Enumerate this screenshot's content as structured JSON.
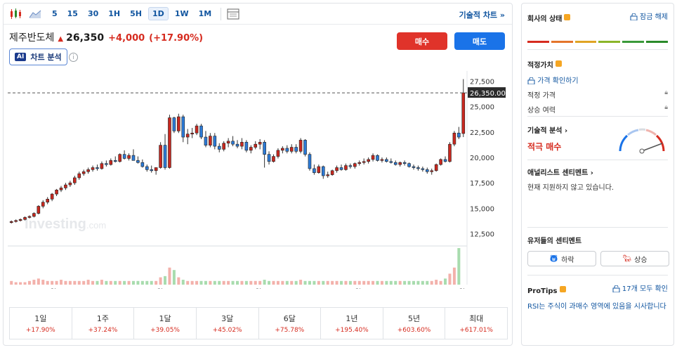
{
  "toolbar": {
    "intervals": [
      "5",
      "15",
      "30",
      "1H",
      "5H",
      "1D",
      "1W",
      "1M"
    ],
    "active_interval": "1D",
    "tech_chart_link": "기술적 차트 »"
  },
  "quote": {
    "name": "제주반도체",
    "price": "26,350",
    "change": "+4,000",
    "change_pct": "(+17.90%)",
    "buy_label": "매수",
    "sell_label": "매도",
    "ai_badge": "AI",
    "ai_label": "차트 분석",
    "info_glyph": "i"
  },
  "chart_data": {
    "type": "candlestick",
    "y_ticks": [
      "27,500",
      "25,000",
      "22,500",
      "20,000",
      "17,500",
      "15,000",
      "12,500"
    ],
    "last_price_label": "26,350.00",
    "x_ticks": [
      "20",
      "월 '25",
      "15",
      "월 '25",
      "20",
      "월 '25",
      "17",
      "월 '25",
      "15",
      "월 '"
    ],
    "watermark": "Investing",
    "watermark_suffix": ".com",
    "ohlc": [
      [
        13600,
        13800,
        13500,
        13700
      ],
      [
        13700,
        13900,
        13600,
        13800
      ],
      [
        13800,
        14000,
        13700,
        13900
      ],
      [
        13900,
        14200,
        13800,
        14100
      ],
      [
        14100,
        14300,
        14000,
        14200
      ],
      [
        14200,
        14600,
        14100,
        14500
      ],
      [
        14500,
        15300,
        14400,
        15200
      ],
      [
        15200,
        15800,
        15000,
        15600
      ],
      [
        15600,
        16100,
        15400,
        15900
      ],
      [
        15900,
        16500,
        15700,
        16400
      ],
      [
        16400,
        16900,
        16200,
        16800
      ],
      [
        16800,
        17200,
        16600,
        17000
      ],
      [
        17000,
        17500,
        16800,
        17300
      ],
      [
        17300,
        17700,
        17100,
        17500
      ],
      [
        17500,
        18200,
        17300,
        18000
      ],
      [
        18000,
        18600,
        17800,
        18400
      ],
      [
        18400,
        18800,
        18200,
        18600
      ],
      [
        18600,
        19000,
        18400,
        18800
      ],
      [
        18800,
        19200,
        18600,
        19000
      ],
      [
        19000,
        19300,
        18700,
        18900
      ],
      [
        18900,
        19600,
        18800,
        19400
      ],
      [
        19400,
        19700,
        19100,
        19300
      ],
      [
        19300,
        19900,
        19200,
        19700
      ],
      [
        19700,
        20100,
        19500,
        19600
      ],
      [
        19600,
        20400,
        19500,
        20300
      ],
      [
        20300,
        20700,
        19800,
        19900
      ],
      [
        19900,
        20400,
        19700,
        20200
      ],
      [
        20200,
        20800,
        19800,
        19700
      ],
      [
        19700,
        20100,
        19400,
        19500
      ],
      [
        19500,
        19800,
        19000,
        19100
      ],
      [
        19100,
        19300,
        18600,
        18800
      ],
      [
        18800,
        19200,
        18500,
        18700
      ],
      [
        18700,
        19000,
        18300,
        19000
      ],
      [
        19000,
        21500,
        18900,
        21200
      ],
      [
        21200,
        22300,
        18800,
        19000
      ],
      [
        19000,
        24200,
        18900,
        23900
      ],
      [
        23900,
        24000,
        22400,
        22600
      ],
      [
        22600,
        24300,
        22400,
        24000
      ],
      [
        24000,
        24200,
        21500,
        22000
      ],
      [
        22000,
        22800,
        21300,
        22300
      ],
      [
        22300,
        22900,
        21900,
        22400
      ],
      [
        22400,
        23300,
        22200,
        23100
      ],
      [
        23100,
        23300,
        21800,
        22000
      ],
      [
        22000,
        22600,
        21000,
        21200
      ],
      [
        21200,
        22400,
        21000,
        22100
      ],
      [
        22100,
        22400,
        20800,
        21100
      ],
      [
        21100,
        21400,
        20500,
        20800
      ],
      [
        20800,
        21600,
        20600,
        21400
      ],
      [
        21400,
        21900,
        21000,
        21600
      ],
      [
        21600,
        22100,
        21100,
        21300
      ],
      [
        21300,
        21700,
        20900,
        21100
      ],
      [
        21100,
        21900,
        20800,
        21500
      ],
      [
        21500,
        21700,
        20500,
        20700
      ],
      [
        20700,
        21200,
        20400,
        21000
      ],
      [
        21000,
        21600,
        20800,
        21300
      ],
      [
        21300,
        21800,
        20800,
        21500
      ],
      [
        21500,
        21700,
        19000,
        20300
      ],
      [
        20300,
        20600,
        19300,
        19600
      ],
      [
        19600,
        20300,
        19500,
        20100
      ],
      [
        20100,
        20900,
        19900,
        20700
      ],
      [
        20700,
        21100,
        20400,
        20900
      ],
      [
        20900,
        21200,
        20400,
        20600
      ],
      [
        20600,
        21300,
        20400,
        21000
      ],
      [
        21000,
        21300,
        20400,
        20600
      ],
      [
        20600,
        21900,
        20400,
        21700
      ],
      [
        21700,
        21800,
        20100,
        20300
      ],
      [
        20300,
        20500,
        18700,
        18900
      ],
      [
        18900,
        19300,
        18300,
        18500
      ],
      [
        18500,
        19300,
        18400,
        19100
      ],
      [
        19100,
        19200,
        17900,
        18200
      ],
      [
        18200,
        18600,
        18000,
        18300
      ],
      [
        18300,
        18800,
        18200,
        18700
      ],
      [
        18700,
        19200,
        18500,
        19000
      ],
      [
        19000,
        19300,
        18700,
        18800
      ],
      [
        18800,
        19400,
        18700,
        19200
      ],
      [
        19200,
        19400,
        18900,
        19100
      ],
      [
        19100,
        19500,
        18900,
        19400
      ],
      [
        19400,
        19700,
        19200,
        19500
      ],
      [
        19500,
        19900,
        19300,
        19600
      ],
      [
        19600,
        20000,
        19400,
        19800
      ],
      [
        19800,
        20400,
        19600,
        20200
      ],
      [
        20200,
        20300,
        19600,
        19700
      ],
      [
        19700,
        20000,
        19500,
        19800
      ],
      [
        19800,
        20000,
        19500,
        19600
      ],
      [
        19600,
        19900,
        19400,
        19500
      ],
      [
        19500,
        19700,
        19200,
        19300
      ],
      [
        19300,
        19600,
        19100,
        19500
      ],
      [
        19500,
        19700,
        19200,
        19400
      ],
      [
        19400,
        19500,
        19000,
        19100
      ],
      [
        19100,
        19300,
        18800,
        19000
      ],
      [
        19000,
        19200,
        18700,
        18900
      ],
      [
        18900,
        19100,
        18600,
        18800
      ],
      [
        18800,
        19000,
        18400,
        18600
      ],
      [
        18600,
        18900,
        18300,
        18700
      ],
      [
        18700,
        19400,
        18600,
        19300
      ],
      [
        19300,
        19900,
        19200,
        19800
      ],
      [
        19800,
        20100,
        19500,
        19600
      ],
      [
        19600,
        21500,
        19500,
        21300
      ],
      [
        21300,
        22600,
        21100,
        22400
      ],
      [
        22400,
        23000,
        21800,
        22000
      ],
      [
        22350,
        27700,
        22000,
        26350
      ]
    ],
    "volume": [
      3,
      2,
      2,
      2,
      3,
      4,
      5,
      4,
      3,
      3,
      3,
      4,
      3,
      3,
      3,
      3,
      3,
      4,
      3,
      3,
      4,
      3,
      3,
      3,
      3,
      3,
      3,
      3,
      3,
      3,
      3,
      3,
      3,
      6,
      7,
      14,
      12,
      6,
      4,
      3,
      3,
      3,
      3,
      3,
      3,
      3,
      3,
      3,
      3,
      3,
      3,
      3,
      3,
      3,
      3,
      3,
      4,
      3,
      3,
      3,
      3,
      3,
      3,
      3,
      4,
      3,
      3,
      3,
      3,
      3,
      3,
      3,
      3,
      3,
      3,
      3,
      3,
      3,
      3,
      3,
      3,
      3,
      3,
      3,
      3,
      3,
      3,
      3,
      3,
      3,
      3,
      3,
      3,
      3,
      4,
      3,
      5,
      9,
      14,
      30
    ],
    "ylim": [
      11500,
      28500
    ]
  },
  "periods": [
    {
      "label": "1일",
      "value": "+17.90%"
    },
    {
      "label": "1주",
      "value": "+37.24%"
    },
    {
      "label": "1달",
      "value": "+39.05%"
    },
    {
      "label": "3달",
      "value": "+45.02%"
    },
    {
      "label": "6달",
      "value": "+75.78%"
    },
    {
      "label": "1년",
      "value": "+195.40%"
    },
    {
      "label": "5년",
      "value": "+603.60%"
    },
    {
      "label": "최대",
      "value": "+617.01%"
    }
  ],
  "side": {
    "company_status": "회사의 상태",
    "unlock_label": "잠금 해제",
    "fair_value_title": "적정가치",
    "check_price": "가격 확인하기",
    "fair_price_label": "적정 가격",
    "upside_label": "상승 여력",
    "tech_title": "기술적 분석 ›",
    "tech_signal": "적극 매수",
    "analyst_title": "애널리스트 센티멘트 ›",
    "analyst_note": "현재 지원하지 않고 있습니다.",
    "user_title": "유저들의 센티멘트",
    "bear_label": "하락",
    "bull_label": "상승",
    "protips_title": "ProTips",
    "protips_unlock": "17개 모두 확인",
    "protips_text": "RSI는 주식이 과매수 영역에 있음을 시사합니다",
    "status_colors": [
      "#d62b1f",
      "#e4752b",
      "#e0a424",
      "#8bb529",
      "#3a9a3a",
      "#2a8a2a"
    ]
  }
}
